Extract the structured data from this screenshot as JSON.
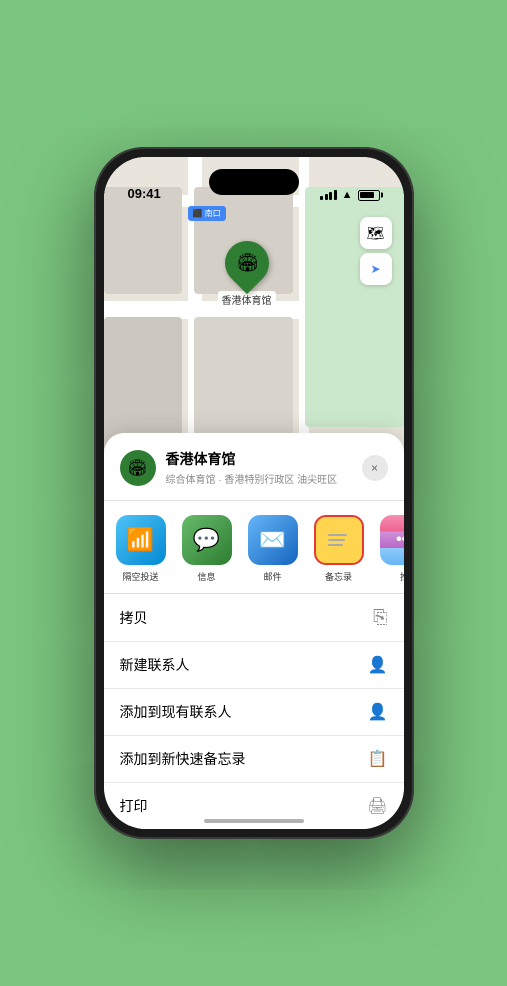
{
  "status_bar": {
    "time": "09:41",
    "location_icon": "▲"
  },
  "map": {
    "north_exit_label": "⬛ 南口",
    "stadium_name": "香港体育馆",
    "stadium_emoji": "🏟"
  },
  "map_controls": {
    "layers_icon": "🗺",
    "location_icon": "➤"
  },
  "location_card": {
    "name": "香港体育馆",
    "subtitle": "综合体育馆 · 香港特别行政区 油尖旺区",
    "close_label": "×"
  },
  "share_items": [
    {
      "label": "隔空投送",
      "type": "airdrop"
    },
    {
      "label": "信息",
      "type": "messages"
    },
    {
      "label": "邮件",
      "type": "mail"
    },
    {
      "label": "备忘录",
      "type": "notes"
    },
    {
      "label": "推",
      "type": "more-dots"
    }
  ],
  "actions": [
    {
      "label": "拷贝",
      "icon": "⎘"
    },
    {
      "label": "新建联系人",
      "icon": "👤"
    },
    {
      "label": "添加到现有联系人",
      "icon": "👤"
    },
    {
      "label": "添加到新快速备忘录",
      "icon": "📋"
    },
    {
      "label": "打印",
      "icon": "🖨"
    }
  ]
}
